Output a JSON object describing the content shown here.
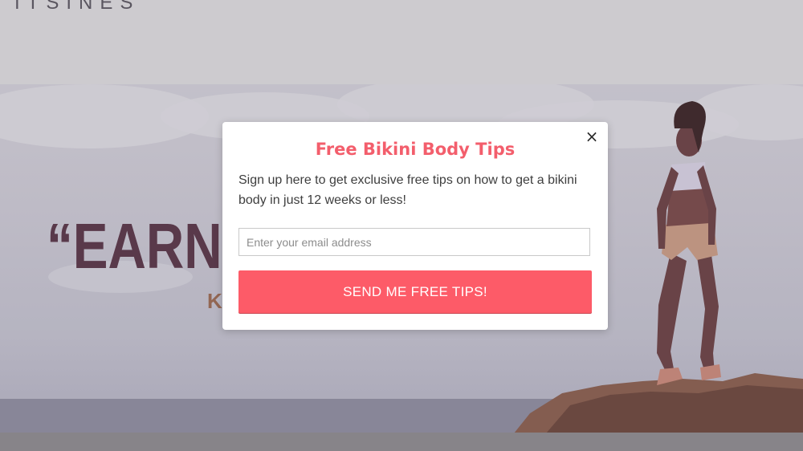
{
  "background_page": {
    "logo_text": "ITSINES",
    "hero_quote": "“EARN Y",
    "hero_quote_author": "K"
  },
  "popup": {
    "title": "Free Bikini Body Tips",
    "description": "Sign up here to get exclusive free tips on how to get a bikini body in just 12 weeks or less!",
    "email_placeholder": "Enter your email address",
    "email_value": "",
    "submit_label": "SEND ME FREE TIPS!",
    "close_label": "×"
  },
  "colors": {
    "accent": "#fd5b68",
    "title": "#f35e6c"
  },
  "icons": {
    "close": "close-icon"
  }
}
